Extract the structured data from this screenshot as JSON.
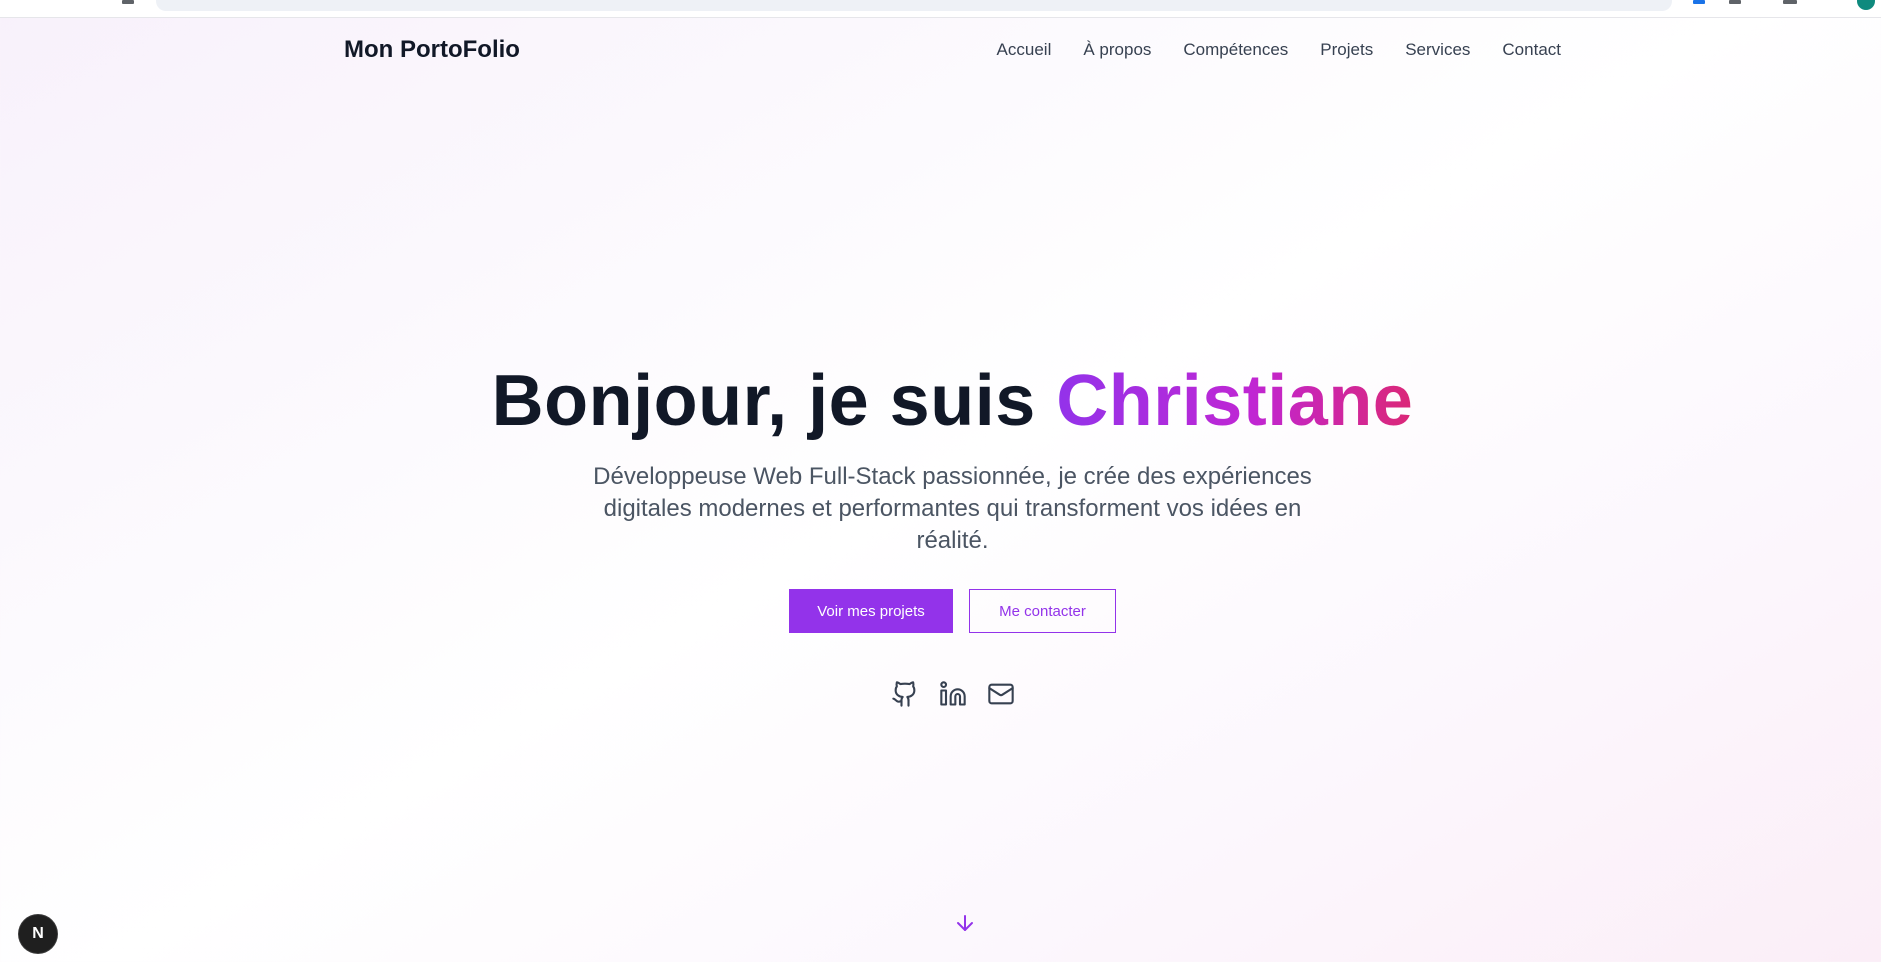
{
  "nav": {
    "brand": "Mon PortoFolio",
    "links": [
      "Accueil",
      "À propos",
      "Compétences",
      "Projets",
      "Services",
      "Contact"
    ]
  },
  "hero": {
    "greeting": "Bonjour, je suis ",
    "name": "Christiane",
    "subtitle": "Développeuse Web Full-Stack passionnée, je crée des expériences digitales modernes et performantes qui transforment vos idées en réalité.",
    "primary_button": "Voir mes projets",
    "secondary_button": "Me contacter"
  },
  "socials": [
    {
      "icon": "github-icon"
    },
    {
      "icon": "linkedin-icon"
    },
    {
      "icon": "mail-icon"
    }
  ],
  "scroll_icon": "arrow-down-icon",
  "dev_badge": {
    "icon": "nextjs-icon",
    "label": "N"
  },
  "colors": {
    "accent": "#9333ea",
    "gradient_end": "#db2777",
    "text_dark": "#111827",
    "text_muted": "#4b5563"
  }
}
